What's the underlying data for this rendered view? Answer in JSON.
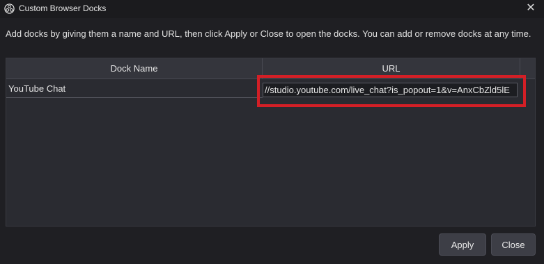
{
  "window": {
    "title": "Custom Browser Docks",
    "app_icon": "obs-logo-icon",
    "close_glyph": "✕"
  },
  "description": "Add docks by giving them a name and URL, then click Apply or Close to open the docks. You can add or remove docks at any time.",
  "table": {
    "columns": [
      "Dock Name",
      "URL"
    ],
    "rows": [
      {
        "name": "YouTube Chat",
        "url": "//studio.youtube.com/live_chat?is_popout=1&v=AnxCbZld5lE"
      }
    ]
  },
  "buttons": {
    "apply": "Apply",
    "close": "Close"
  },
  "colors": {
    "highlight": "#d31f26",
    "background": "#1f1f23"
  }
}
